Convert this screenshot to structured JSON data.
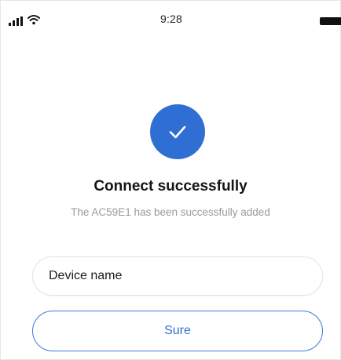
{
  "status_bar": {
    "time": "9:28",
    "signal_icon": "signal-bars-icon",
    "wifi_icon": "wifi-icon",
    "battery_icon": "battery-icon"
  },
  "result": {
    "icon": "check-icon",
    "icon_color": "#2f6fd3",
    "title": "Connect successfully",
    "message": "The AC59E1 has been successfully added"
  },
  "form": {
    "device_name_placeholder": "Device name",
    "device_name_value": ""
  },
  "actions": {
    "sure_label": "Sure",
    "accent_color": "#2f6fd3"
  }
}
